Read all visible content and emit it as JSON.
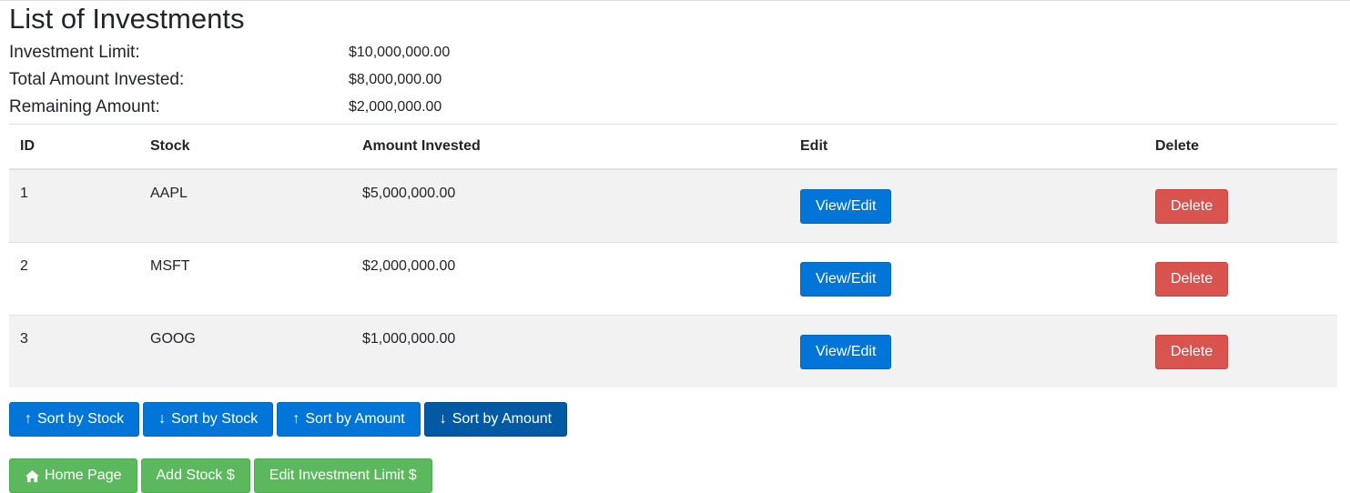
{
  "page": {
    "title": "List of Investments"
  },
  "summary": {
    "investment_limit_label": "Investment Limit:",
    "investment_limit_value": "$10,000,000.00",
    "total_invested_label": "Total Amount Invested:",
    "total_invested_value": "$8,000,000.00",
    "remaining_label": "Remaining Amount:",
    "remaining_value": "$2,000,000.00"
  },
  "table": {
    "headers": [
      "ID",
      "Stock",
      "Amount Invested",
      "Edit",
      "Delete"
    ],
    "rows": [
      {
        "id": "1",
        "stock": "AAPL",
        "amount": "$5,000,000.00",
        "edit_label": "View/Edit",
        "delete_label": "Delete"
      },
      {
        "id": "2",
        "stock": "MSFT",
        "amount": "$2,000,000.00",
        "edit_label": "View/Edit",
        "delete_label": "Delete"
      },
      {
        "id": "3",
        "stock": "GOOG",
        "amount": "$1,000,000.00",
        "edit_label": "View/Edit",
        "delete_label": "Delete"
      }
    ]
  },
  "sort_bar": {
    "stock_asc": {
      "arrow": "↑",
      "label": "Sort by Stock"
    },
    "stock_desc": {
      "arrow": "↓",
      "label": "Sort by Stock"
    },
    "amount_asc": {
      "arrow": "↑",
      "label": "Sort by Amount"
    },
    "amount_desc": {
      "arrow": "↓",
      "label": "Sort by Amount"
    }
  },
  "nav": {
    "home_label": "Home Page",
    "home_icon": "home-icon",
    "add_stock_label": "Add Stock $",
    "edit_limit_label": "Edit Investment Limit $"
  },
  "colors": {
    "primary": "#0275d8",
    "primary_active": "#025aa5",
    "danger": "#d9534f",
    "success": "#5cb85c",
    "striped_row": "#f2f2f2"
  }
}
